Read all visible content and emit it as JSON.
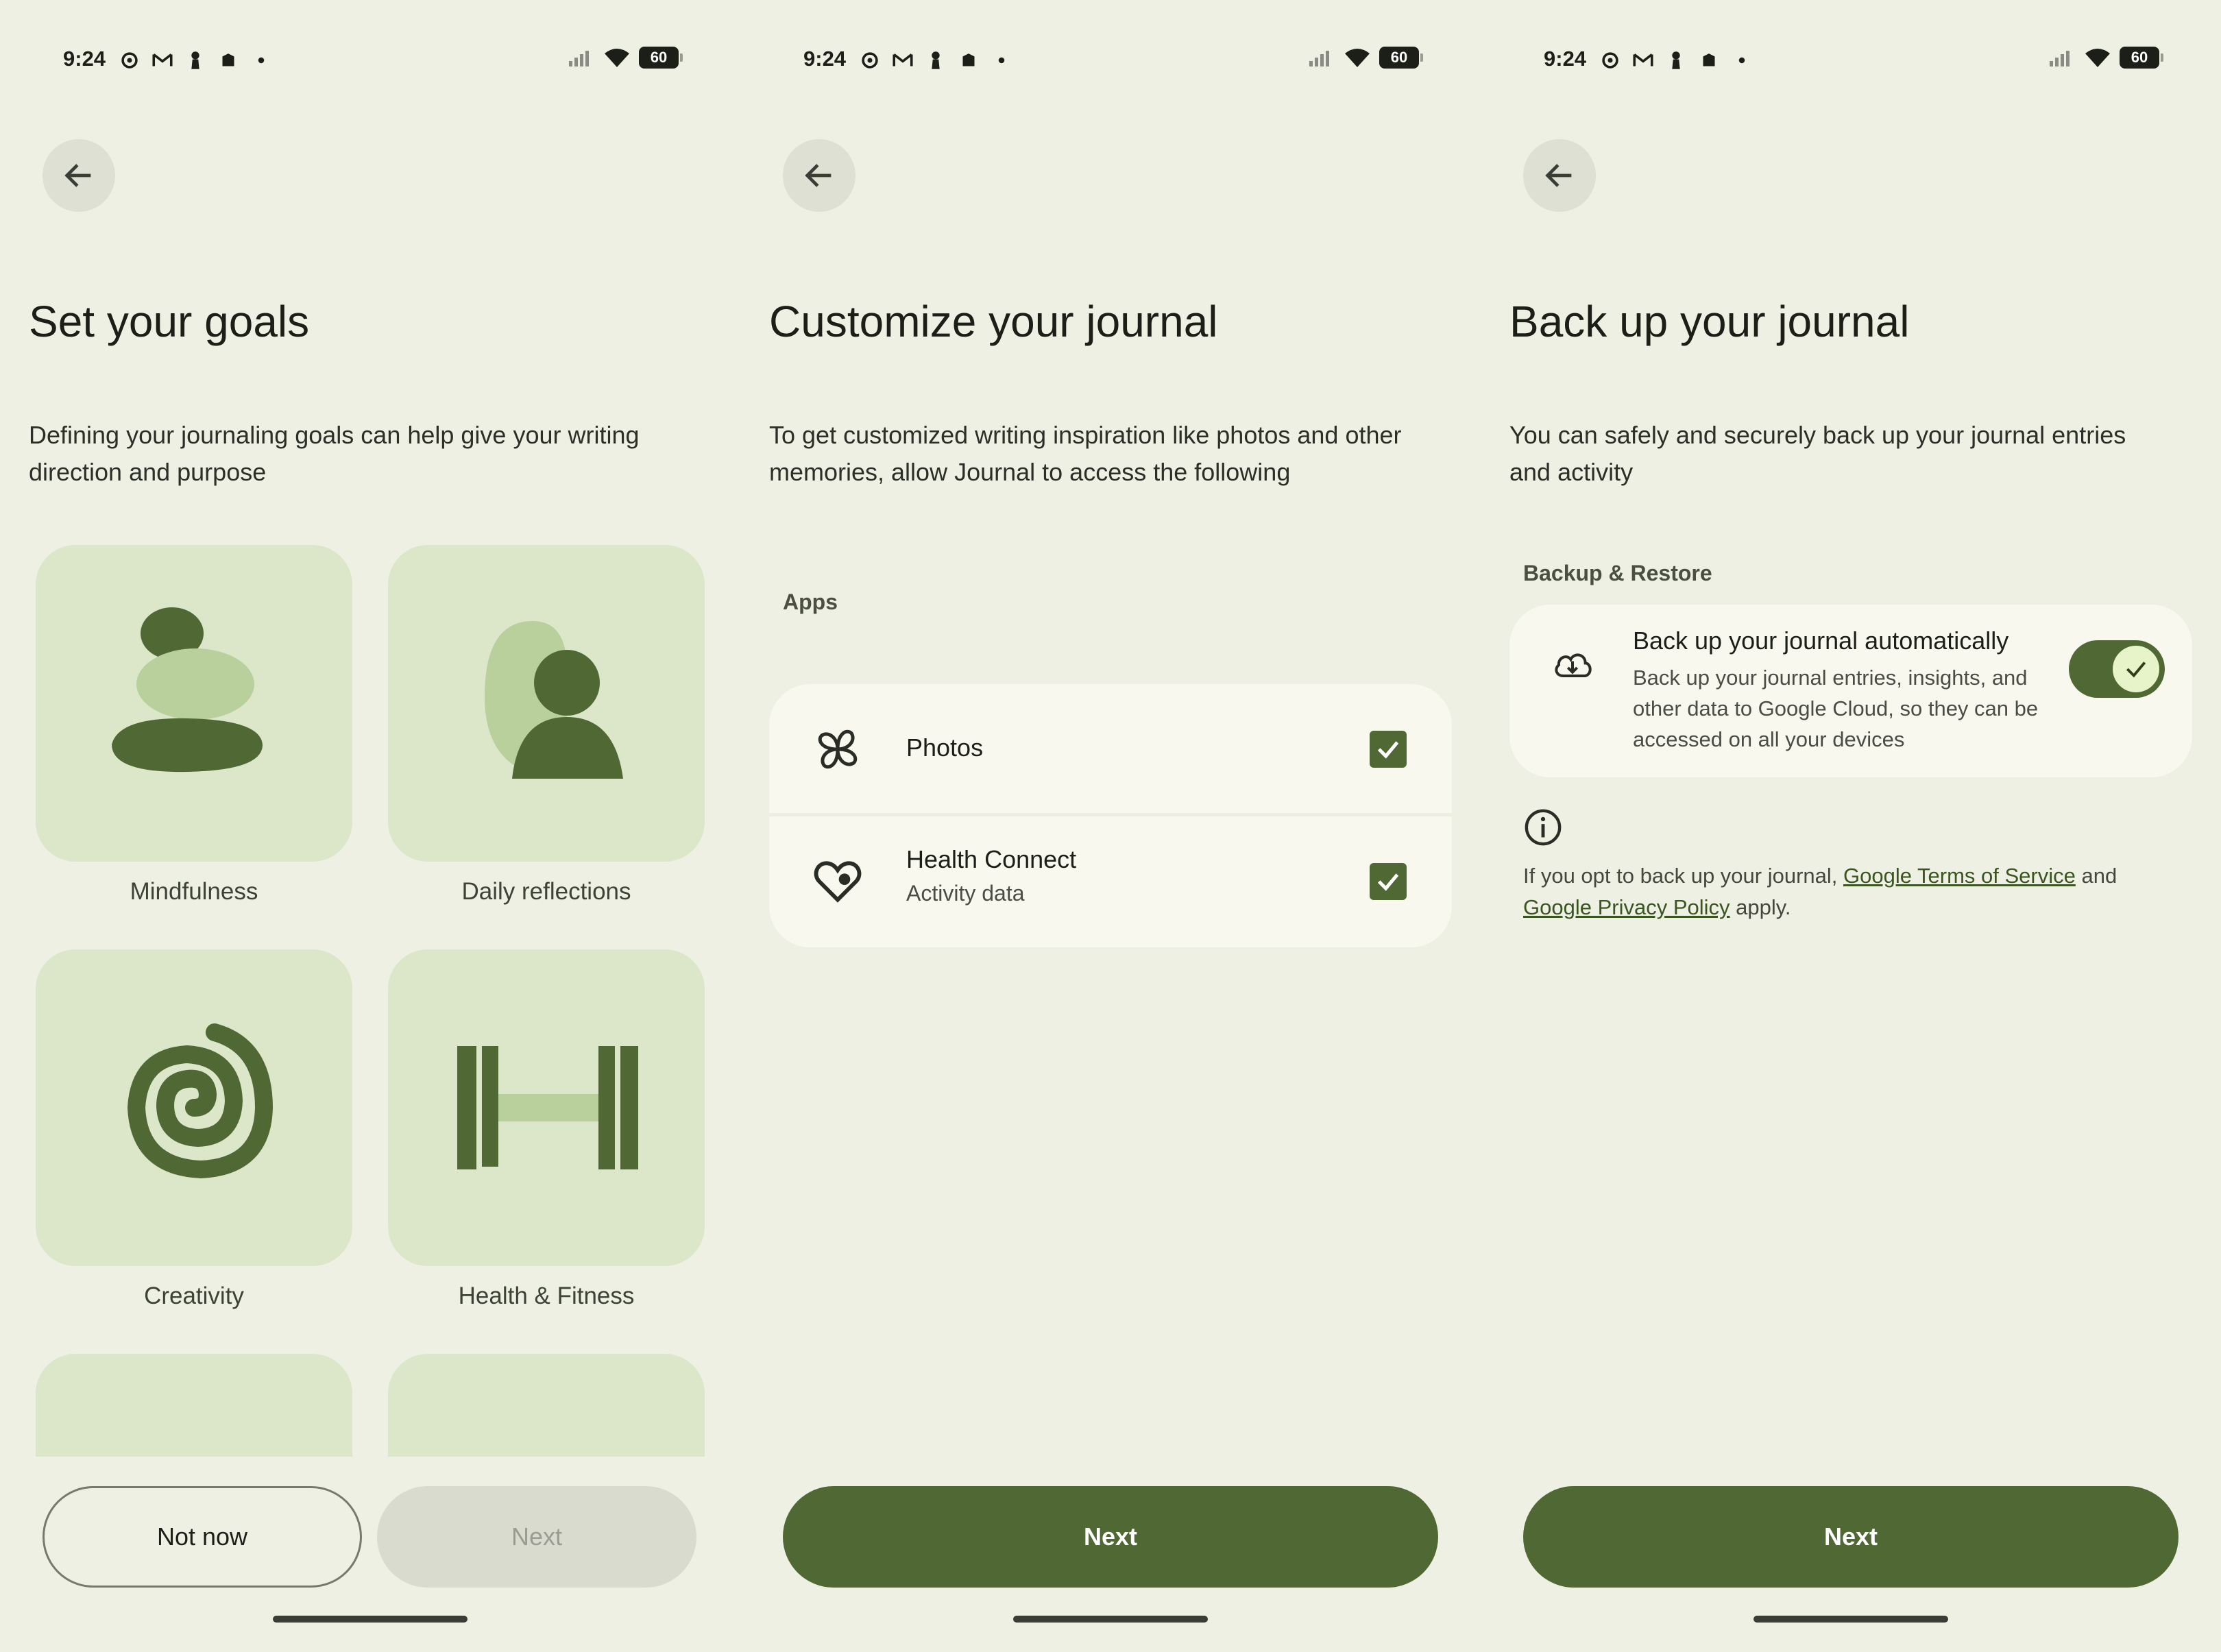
{
  "status_bar": {
    "time": "9:24",
    "battery": "60",
    "left_icons": [
      "vpn-icon",
      "gmail-icon",
      "keyhole-icon",
      "app-icon",
      "dot-icon"
    ],
    "right_icons": [
      "signal-icon",
      "wifi-icon",
      "battery-icon"
    ]
  },
  "colors": {
    "background": "#eef0e3",
    "tile": "#dce7c9",
    "accent_dark": "#4f6834",
    "accent_light": "#b9cf9c",
    "card": "#f8f8ef"
  },
  "screen1": {
    "title": "Set your goals",
    "description": "Defining your journaling goals can help give your writing direction and purpose",
    "goals": [
      {
        "label": "Mindfulness",
        "icon": "stacked-stones-icon"
      },
      {
        "label": "Daily reflections",
        "icon": "person-reflection-icon"
      },
      {
        "label": "Creativity",
        "icon": "spiral-icon"
      },
      {
        "label": "Health & Fitness",
        "icon": "dumbbell-icon"
      }
    ],
    "not_now_label": "Not now",
    "next_label": "Next"
  },
  "screen2": {
    "title": "Customize your journal",
    "description": "To get customized writing inspiration like photos and other memories, allow Journal to access the following",
    "apps_label": "Apps",
    "apps": [
      {
        "name": "Photos",
        "subtitle": "",
        "icon": "photos-pinwheel-icon",
        "checked": true
      },
      {
        "name": "Health Connect",
        "subtitle": "Activity data",
        "icon": "health-connect-icon",
        "checked": true
      }
    ],
    "next_label": "Next"
  },
  "screen3": {
    "title": "Back up your journal",
    "description": "You can safely and securely back up your journal entries and activity",
    "section_label": "Backup & Restore",
    "backup_title": "Back up your journal automatically",
    "backup_desc": "Back up your journal entries, insights, and other data to Google Cloud, so they can be accessed on all your devices",
    "toggle_on": true,
    "legal_prefix": "If you opt to back up your journal, ",
    "terms_link": "Google Terms of Service",
    "legal_and": " and ",
    "privacy_link": "Google Privacy Policy",
    "legal_suffix": " apply.",
    "next_label": "Next"
  }
}
